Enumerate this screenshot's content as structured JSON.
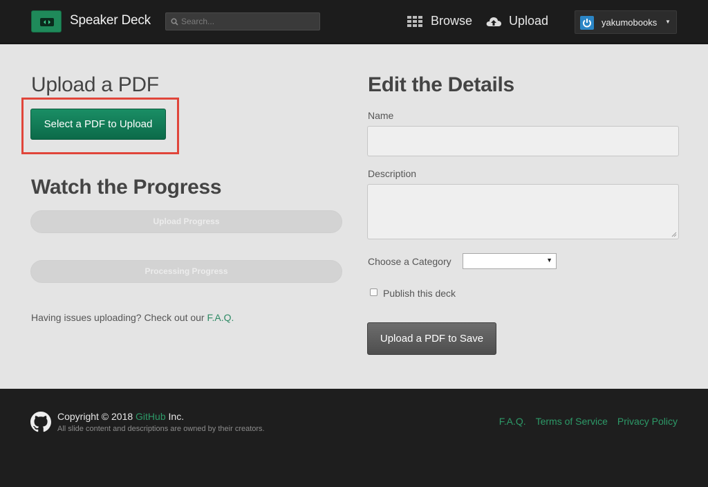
{
  "header": {
    "brand": "Speaker Deck",
    "search_placeholder": "Search...",
    "browse_label": "Browse",
    "upload_label": "Upload",
    "username": "yakumobooks"
  },
  "upload_section": {
    "title": "Upload a PDF",
    "select_button": "Select a PDF to Upload"
  },
  "progress_section": {
    "title": "Watch the Progress",
    "upload_progress": "Upload Progress",
    "processing_progress": "Processing Progress",
    "help_text": "Having issues uploading? Check out our ",
    "help_link": "F.A.Q."
  },
  "details": {
    "title": "Edit the Details",
    "name_label": "Name",
    "name_value": "",
    "description_label": "Description",
    "description_value": "",
    "category_label": "Choose a Category",
    "category_value": "",
    "publish_label": "Publish this deck",
    "publish_checked": false,
    "save_button": "Upload a PDF to Save"
  },
  "footer": {
    "copyright_prefix": "Copyright © 2018 ",
    "copyright_link": "GitHub",
    "copyright_suffix": " Inc.",
    "subtext": "All slide content and descriptions are owned by their creators.",
    "links": [
      "F.A.Q.",
      "Terms of Service",
      "Privacy Policy"
    ]
  },
  "colors": {
    "accent_green": "#1a8e65",
    "link_green": "#2d9a68",
    "highlight_red": "#e0453a"
  }
}
